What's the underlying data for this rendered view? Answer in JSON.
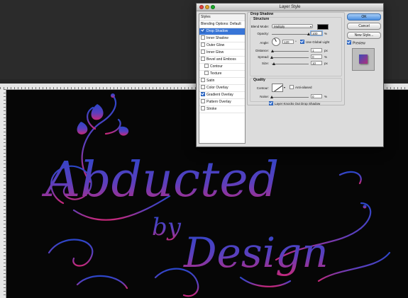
{
  "dialog": {
    "title": "Layer Style",
    "styles_header": "Styles",
    "style_items": [
      {
        "label": "Blending Options: Default",
        "checkbox": false,
        "checked": false,
        "selected": false,
        "sub": false
      },
      {
        "label": "Drop Shadow",
        "checkbox": true,
        "checked": true,
        "selected": true,
        "sub": false
      },
      {
        "label": "Inner Shadow",
        "checkbox": true,
        "checked": false,
        "selected": false,
        "sub": false
      },
      {
        "label": "Outer Glow",
        "checkbox": true,
        "checked": false,
        "selected": false,
        "sub": false
      },
      {
        "label": "Inner Glow",
        "checkbox": true,
        "checked": false,
        "selected": false,
        "sub": false
      },
      {
        "label": "Bevel and Emboss",
        "checkbox": true,
        "checked": false,
        "selected": false,
        "sub": false
      },
      {
        "label": "Contour",
        "checkbox": true,
        "checked": false,
        "selected": false,
        "sub": true
      },
      {
        "label": "Texture",
        "checkbox": true,
        "checked": false,
        "selected": false,
        "sub": true
      },
      {
        "label": "Satin",
        "checkbox": true,
        "checked": false,
        "selected": false,
        "sub": false
      },
      {
        "label": "Color Overlay",
        "checkbox": true,
        "checked": false,
        "selected": false,
        "sub": false
      },
      {
        "label": "Gradient Overlay",
        "checkbox": true,
        "checked": true,
        "selected": false,
        "sub": false
      },
      {
        "label": "Pattern Overlay",
        "checkbox": true,
        "checked": false,
        "selected": false,
        "sub": false
      },
      {
        "label": "Stroke",
        "checkbox": true,
        "checked": false,
        "selected": false,
        "sub": false
      }
    ],
    "section_title": "Drop Shadow",
    "structure": {
      "title": "Structure",
      "blend_mode_label": "Blend Mode:",
      "blend_mode_value": "Multiply",
      "shadow_color": "#000000",
      "opacity_label": "Opacity:",
      "opacity_value": "100",
      "opacity_fraction": 1.0,
      "angle_label": "Angle:",
      "angle_value": "120",
      "global_light_label": "Use Global Light",
      "global_light_checked": true,
      "distance_label": "Distance:",
      "distance_value": "1",
      "spread_label": "Spread:",
      "spread_value": "0",
      "size_label": "Size:",
      "size_value": "10",
      "unit_percent": "%",
      "unit_degree": "°",
      "unit_px": "px"
    },
    "quality": {
      "title": "Quality",
      "contour_label": "Contour:",
      "anti_aliased_label": "Anti-aliased",
      "anti_aliased_checked": false,
      "noise_label": "Noise:",
      "noise_value": "0",
      "noise_unit": "%"
    },
    "knockout_label": "Layer Knocks Out Drop Shadow",
    "knockout_checked": true,
    "buttons": {
      "ok": "OK",
      "cancel": "Cancel",
      "new_style": "New Style..."
    },
    "preview_label": "Preview",
    "preview_checked": true
  },
  "artwork": {
    "line1": "Abducted",
    "line2": "by",
    "line3": "Design",
    "gradient_top": "#2b46c9",
    "gradient_bottom": "#c8287a"
  },
  "colors": {
    "accent": "#3875d7",
    "canvas": "#060606",
    "dialog": "#dcdcdc"
  }
}
